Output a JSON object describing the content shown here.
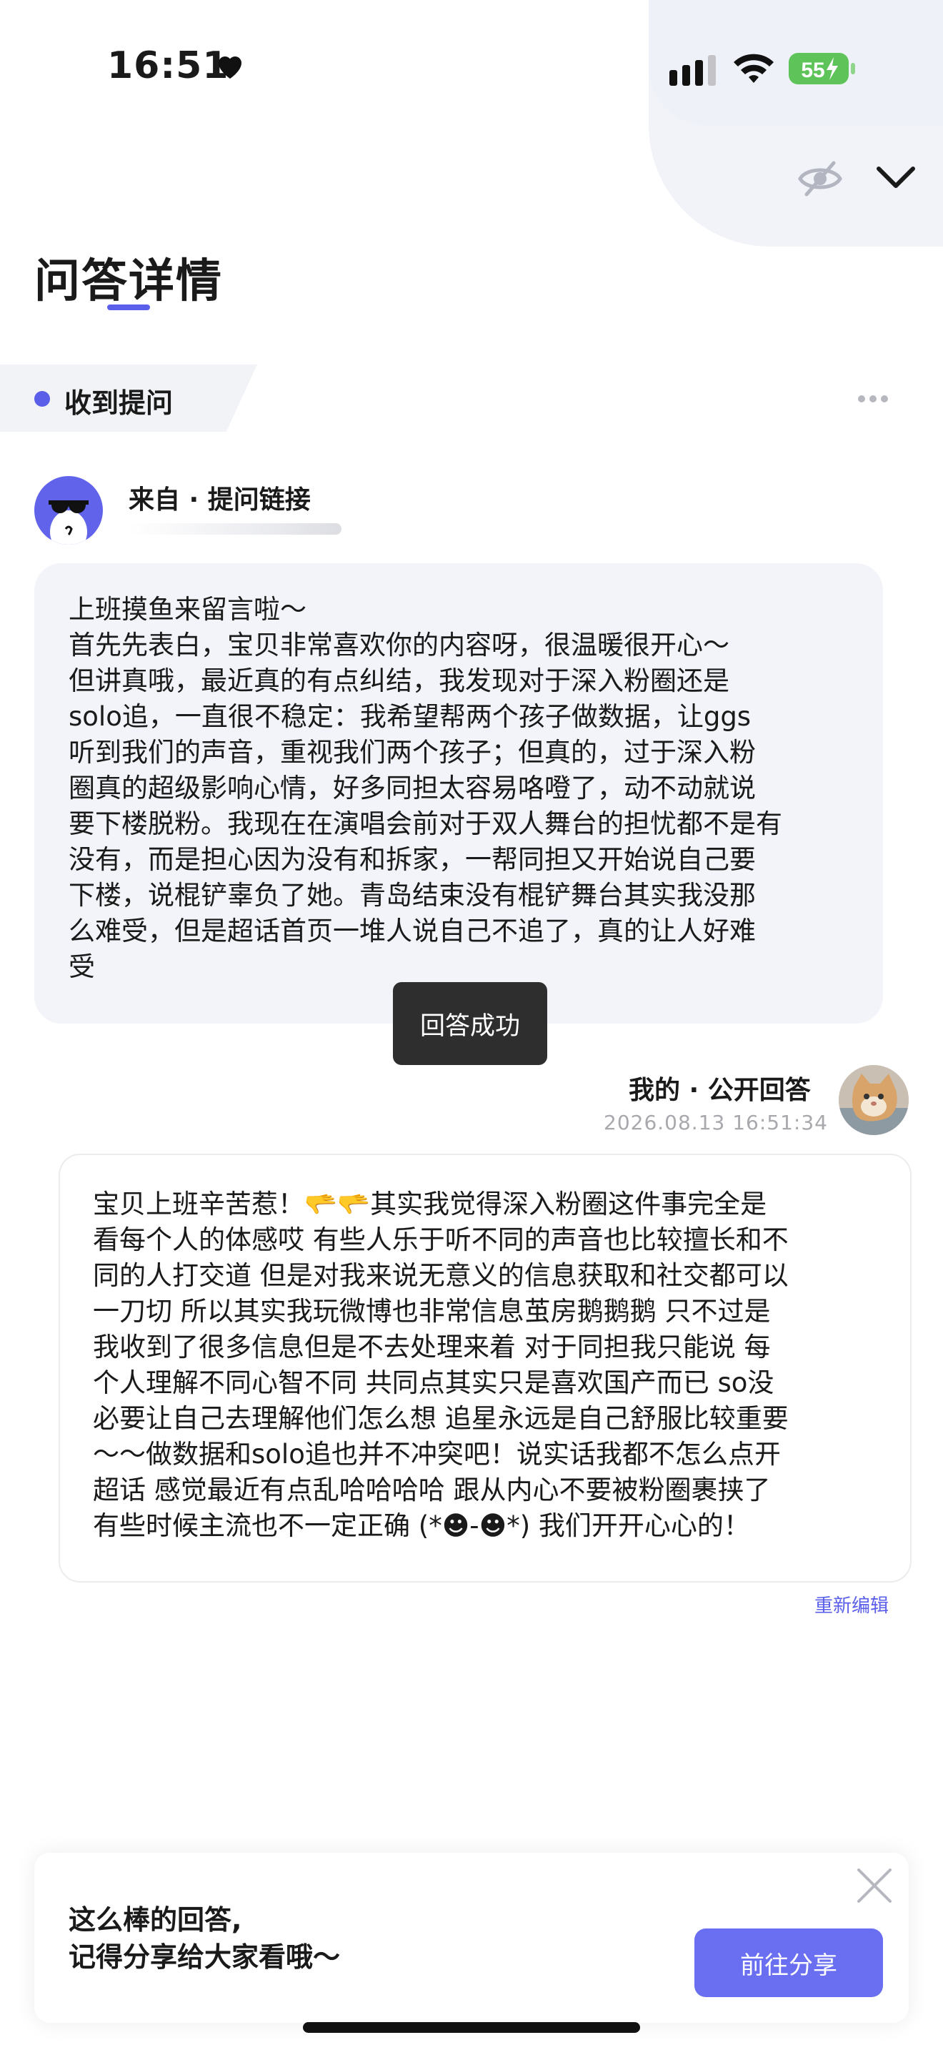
{
  "status_bar": {
    "time": "16:51",
    "battery": "55"
  },
  "header": {
    "title": "问答详情"
  },
  "question": {
    "tag": "收到提问",
    "from": "来自 · 提问链接",
    "text": "上班摸鱼来留言啦～\n首先先表白，宝贝非常喜欢你的内容呀，很温暖很开心～\n但讲真哦，最近真的有点纠结，我发现对于深入粉圈还是\nsolo追，一直很不稳定：我希望帮两个孩子做数据，让ggs\n听到我们的声音，重视我们两个孩子；但真的，过于深入粉\n圈真的超级影响心情，好多同担太容易咯噔了，动不动就说\n要下楼脱粉。我现在在演唱会前对于双人舞台的担忧都不是有\n没有，而是担心因为没有和拆家，一帮同担又开始说自己要\n下楼，说棍铲辜负了她。青岛结束没有棍铲舞台其实我没那\n么难受，但是超话首页一堆人说自己不追了，真的让人好难\n受"
  },
  "toast": "回答成功",
  "answer": {
    "label": "我的 · 公开回答",
    "time": "2026.08.13 16:51:34",
    "text": "宝贝上班辛苦惹！🫳🫳其实我觉得深入粉圈这件事完全是\n看每个人的体感哎 有些人乐于听不同的声音也比较擅长和不\n同的人打交道 但是对我来说无意义的信息获取和社交都可以\n一刀切 所以其实我玩微博也非常信息茧房鹅鹅鹅 只不过是\n我收到了很多信息但是不去处理来着 对于同担我只能说 每\n个人理解不同心智不同 共同点其实只是喜欢国产而已 so没\n必要让自己去理解他们怎么想 追星永远是自己舒服比较重要\n～～做数据和solo追也并不冲突吧！说实话我都不怎么点开\n超话 感觉最近有点乱哈哈哈哈 跟从内心不要被粉圈裹挟了\n有些时候主流也不一定正确 (*☻-☻*) 我们开开心心的！",
    "reedit": "重新编辑"
  },
  "share": {
    "text": "这么棒的回答,\n记得分享给大家看哦～",
    "button": "前往分享"
  },
  "colors": {
    "accent": "#5a5ee8",
    "button": "#6a6ef0",
    "battery": "#5ec45a"
  }
}
